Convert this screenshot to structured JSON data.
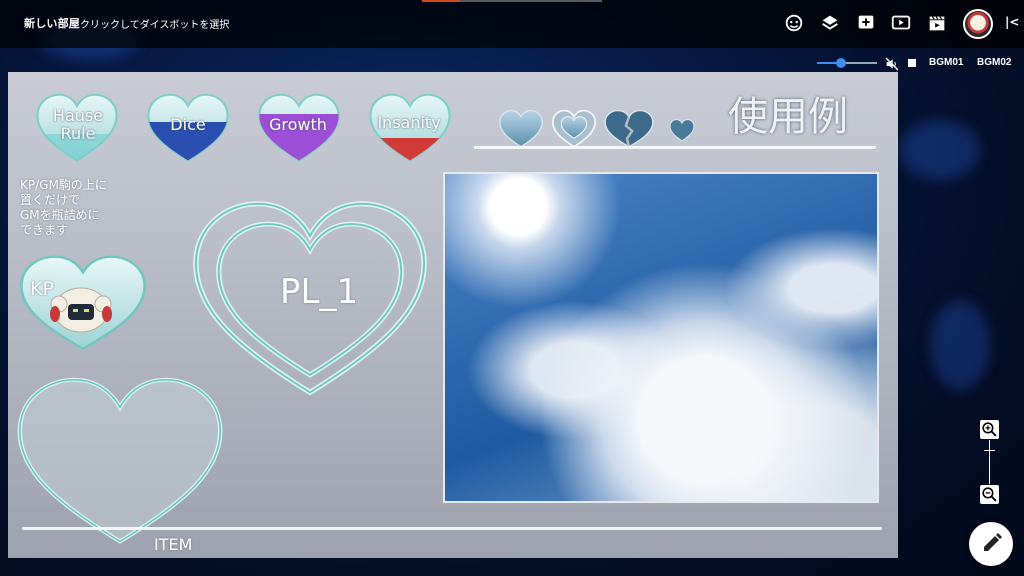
{
  "room": {
    "title": "新しい部屋",
    "subtitle": "クリックしてダイスボットを選択"
  },
  "toolbar": {
    "icons": [
      "face-icon",
      "layers-icon",
      "add-box-icon",
      "play-screen-icon",
      "clapperboard-icon",
      "user-avatar",
      "collapse-icon"
    ]
  },
  "audio": {
    "volume_percent": 40,
    "bgm1": "BGM01",
    "bgm2": "BGM02"
  },
  "board": {
    "hearts_top": [
      {
        "label": "Hause\nRule",
        "fill_color": "#6fd0d2"
      },
      {
        "label": "Dice",
        "fill_color": "#2a4fb0"
      },
      {
        "label": "Growth",
        "fill_color": "#9c4fd6"
      },
      {
        "label": "Insanity",
        "fill_color": "#d23a3a"
      }
    ],
    "example_title": "使用例",
    "note": "KP/GM駒の上に\n置くだけで\nGMを瓶詰めに\nできます",
    "kp_label": "KP",
    "pl_label": "PL_1",
    "item_label": "ITEM"
  },
  "colors": {
    "heart_glass": "#bfe9ea",
    "heart_edge": "#6fc7c0",
    "accent_blue": "#3b8df0"
  }
}
